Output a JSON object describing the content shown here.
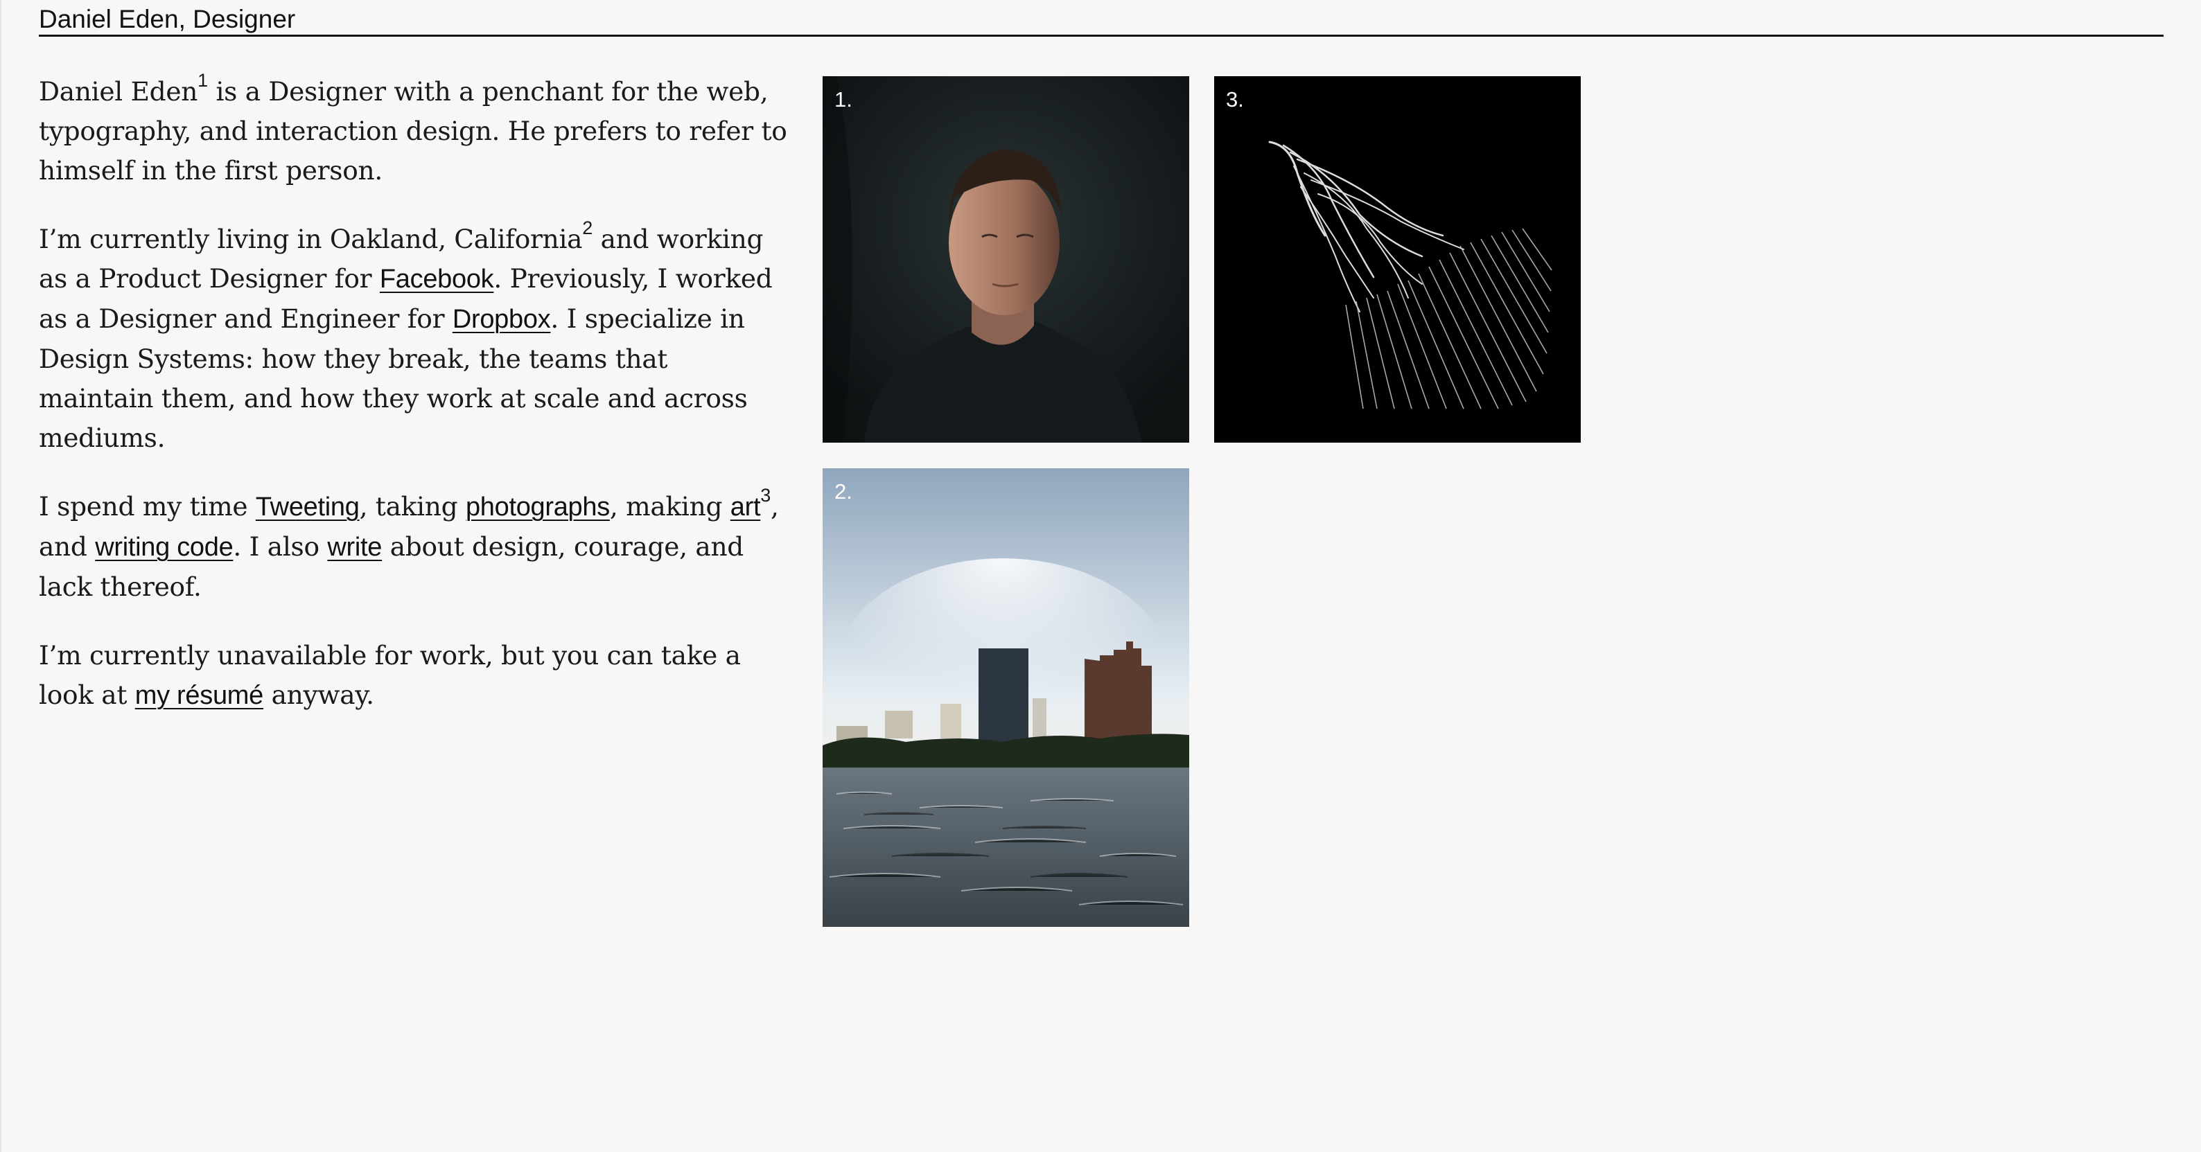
{
  "header": {
    "title": "Daniel Eden, Designer"
  },
  "bio": {
    "p1": {
      "name": "Daniel Eden",
      "sup1": "1",
      "rest_line": " is a Designer with a penchant for the web, typography, and interaction design. He prefers to refer to himself in the first person."
    },
    "p2": {
      "t1": "I’m currently living in Oakland, California",
      "sup2": "2",
      "t2": " and working as a Product Designer for ",
      "facebook": "Facebook",
      "t3": ". Previously, I worked as a Designer and Engineer for ",
      "dropbox": "Dropbox",
      "t4": ". I specialize in Design Systems: how they break, the teams that maintain them, and how they work at scale and across mediums."
    },
    "p3": {
      "t1": "I spend my time ",
      "tweeting": "Tweeting",
      "t2": ", taking ",
      "photographs": "photographs",
      "t3": ", making ",
      "art": "art",
      "sup3": "3",
      "t4": ", and ",
      "writing_code": "writing code",
      "t5": ". I also ",
      "write": "write",
      "t6": " about design, courage, and lack thereof."
    },
    "p4": {
      "t1": "I’m currently unavailable for work, but you can take a look at ",
      "resume": "my résumé",
      "t2": " anyway."
    }
  },
  "photos": [
    {
      "label": "1.",
      "subject": "portrait"
    },
    {
      "label": "3.",
      "subject": "generative-art"
    },
    {
      "label": "2.",
      "subject": "oakland-lake-skyline"
    }
  ]
}
